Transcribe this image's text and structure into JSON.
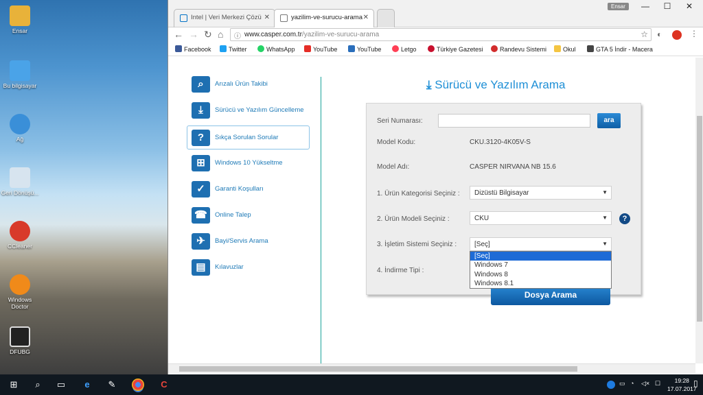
{
  "desktop": {
    "icons": [
      {
        "label": "Ensar",
        "icon": "user-folder-icon",
        "color": "#e8b23a"
      },
      {
        "label": "Bu bilgisayar",
        "icon": "computer-icon",
        "color": "#4aa3e8"
      },
      {
        "label": "Ağ",
        "icon": "network-icon",
        "color": "#3a8fd8"
      },
      {
        "label": "Geri Dönüşü...",
        "icon": "recycle-bin-icon",
        "color": "#d7e4ef"
      },
      {
        "label": "CCleaner",
        "icon": "ccleaner-icon",
        "color": "#d83a2a"
      },
      {
        "label": "Windows Doctor",
        "icon": "windows-doctor-icon",
        "color": "#f08a1a"
      },
      {
        "label": "DFUBG",
        "icon": "dfubg-icon",
        "color": "#222222"
      }
    ]
  },
  "browser": {
    "user": "Ensar",
    "tabs": [
      {
        "title": "Intel | Veri Merkezi Çözü",
        "active": false
      },
      {
        "title": "yazilim-ve-surucu-arama",
        "active": true
      }
    ],
    "url_host": "www.casper.com.tr",
    "url_path": "/yazilim-ve-surucu-arama",
    "bookmarks": [
      {
        "label": "Facebook",
        "color": "#3b5998"
      },
      {
        "label": "Twitter",
        "color": "#1da1f2"
      },
      {
        "label": "WhatsApp",
        "color": "#25d366"
      },
      {
        "label": "YouTube",
        "color": "#e52d27"
      },
      {
        "label": "YouTube",
        "color": "#2a6ebb"
      },
      {
        "label": "Letgo",
        "color": "#ff3f55"
      },
      {
        "label": "Türkiye Gazetesi",
        "color": "#c8102e"
      },
      {
        "label": "Randevu Sistemi",
        "color": "#d22c2c"
      },
      {
        "label": "Okul",
        "color": "#f4c542"
      },
      {
        "label": "GTA 5 İndir - Macera",
        "color": "#444444"
      }
    ]
  },
  "sidebar": {
    "items": [
      {
        "label": "Arızalı Ürün Takibi",
        "icon": "magnifier-icon",
        "glyph": "⌕"
      },
      {
        "label": "Sürücü ve Yazılım Güncelleme",
        "icon": "download-icon",
        "glyph": "⤓"
      },
      {
        "label": "Sıkça Sorulan Sorular",
        "icon": "question-icon",
        "glyph": "?"
      },
      {
        "label": "Windows 10 Yükseltme",
        "icon": "windows-icon",
        "glyph": "⊞"
      },
      {
        "label": "Garanti Koşulları",
        "icon": "checkbox-icon",
        "glyph": "✓"
      },
      {
        "label": "Online Talep",
        "icon": "handshake-icon",
        "glyph": "☎"
      },
      {
        "label": "Bayi/Servis Arama",
        "icon": "map-pin-icon",
        "glyph": "✈"
      },
      {
        "label": "Kılavuzlar",
        "icon": "manual-icon",
        "glyph": "▤"
      }
    ],
    "active_index": 2
  },
  "main": {
    "title": "Sürücü ve Yazılım Arama",
    "serial_label": "Seri Numarası:",
    "serial_value": "",
    "search_button": "ara",
    "model_code_label": "Model Kodu:",
    "model_code_value": "CKU.3120-4K05V-S",
    "model_name_label": "Model Adı:",
    "model_name_value": "CASPER NIRVANA NB 15.6",
    "category_label": "1. Ürün Kategorisi Seçiniz :",
    "category_value": "Dizüstü Bilgisayar",
    "model_label": "2. Ürün Modeli Seçiniz :",
    "model_value": "CKU",
    "os_label": "3. İşletim Sistemi Seçiniz :",
    "os_value": "[Seç]",
    "os_options": [
      "[Seç]",
      "Windows 7",
      "Windows 8",
      "Windows 8.1"
    ],
    "download_type_label": "4. İndirme Tipi :",
    "file_search_button": "Dosya Arama"
  },
  "taskbar": {
    "time": "19:28",
    "date": "17.07.2017"
  }
}
